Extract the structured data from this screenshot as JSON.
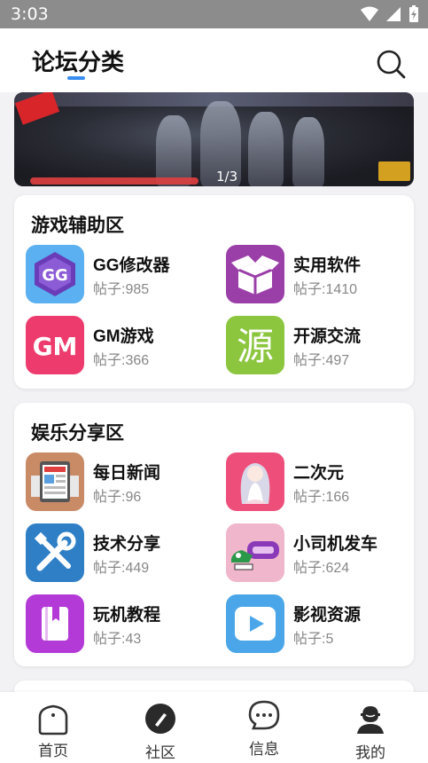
{
  "status": {
    "time": "3:03"
  },
  "header": {
    "title": "论坛分类"
  },
  "banner": {
    "counter": "1/3"
  },
  "sections": [
    {
      "title": "游戏辅助区",
      "items": [
        {
          "name": "GG修改器",
          "count": "帖子:985",
          "icon": "gg-modifier-icon",
          "icon_text": "GG"
        },
        {
          "name": "实用软件",
          "count": "帖子:1410",
          "icon": "box-icon"
        },
        {
          "name": "GM游戏",
          "count": "帖子:366",
          "icon": "gm-game-icon",
          "icon_text": "GM"
        },
        {
          "name": "开源交流",
          "count": "帖子:497",
          "icon": "open-source-icon",
          "icon_text": "源"
        }
      ]
    },
    {
      "title": "娱乐分享区",
      "items": [
        {
          "name": "每日新闻",
          "count": "帖子:96",
          "icon": "newspaper-icon"
        },
        {
          "name": "二次元",
          "count": "帖子:166",
          "icon": "anime-girl-icon"
        },
        {
          "name": "技术分享",
          "count": "帖子:449",
          "icon": "tools-icon"
        },
        {
          "name": "小司机发车",
          "count": "帖子:624",
          "icon": "car-badge-icon"
        },
        {
          "name": "玩机教程",
          "count": "帖子:43",
          "icon": "book-icon"
        },
        {
          "name": "影视资源",
          "count": "帖子:5",
          "icon": "play-icon"
        }
      ]
    }
  ],
  "tabs": [
    {
      "label": "首页",
      "icon": "home-icon"
    },
    {
      "label": "社区",
      "icon": "community-icon"
    },
    {
      "label": "信息",
      "icon": "message-icon"
    },
    {
      "label": "我的",
      "icon": "user-icon"
    }
  ],
  "colors": {
    "accent": "#3a8ef0"
  }
}
